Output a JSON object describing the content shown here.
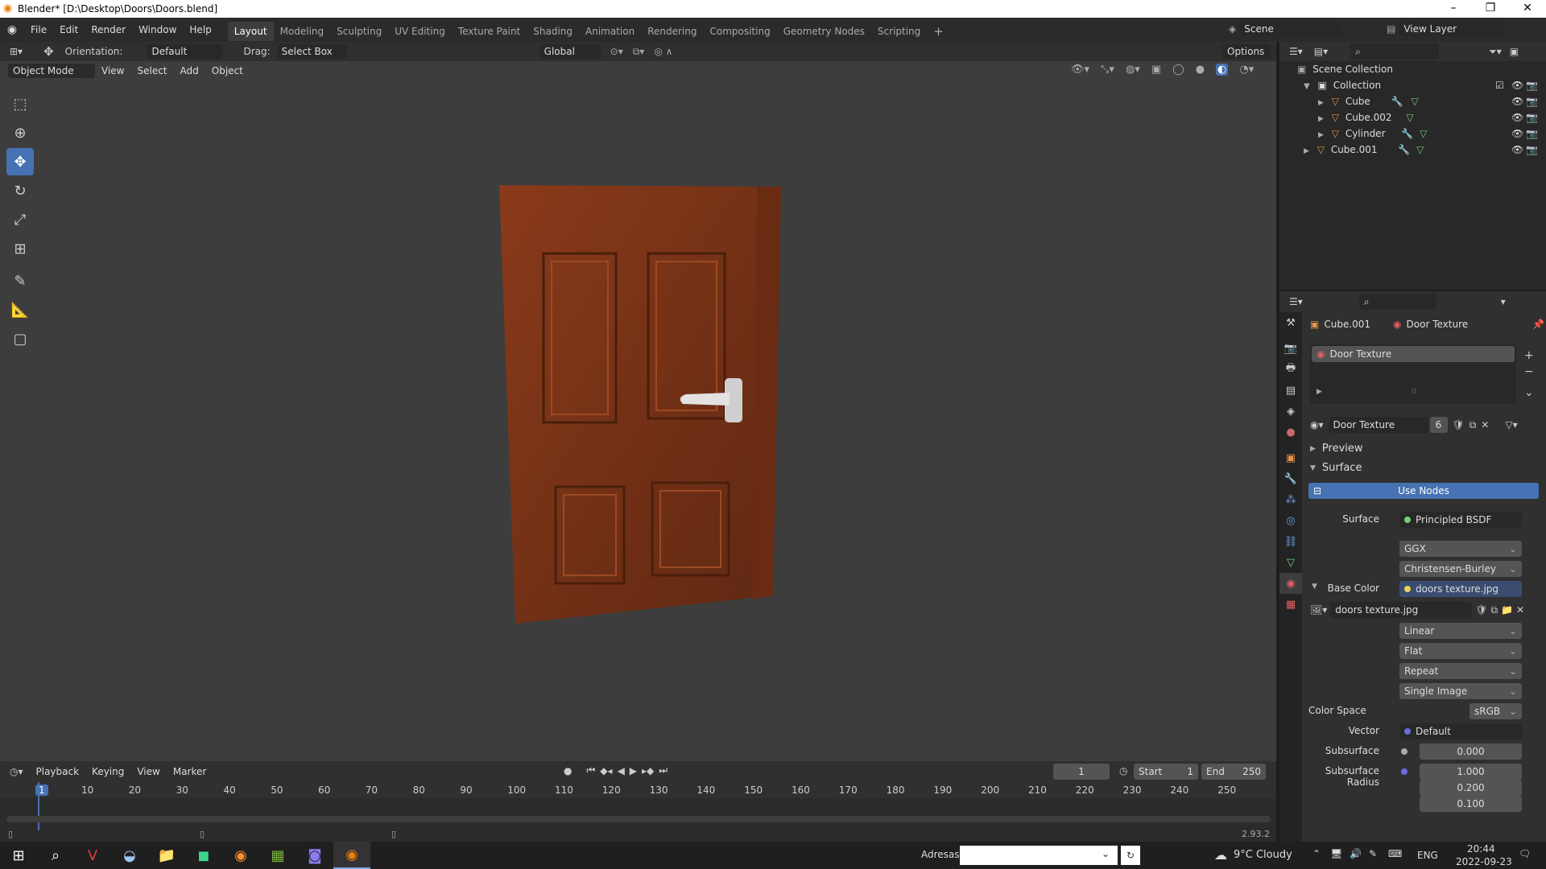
{
  "window": {
    "title": "Blender* [D:\\Desktop\\Doors\\Doors.blend]"
  },
  "menu": [
    "File",
    "Edit",
    "Render",
    "Window",
    "Help"
  ],
  "workspaces": [
    "Layout",
    "Modeling",
    "Sculpting",
    "UV Editing",
    "Texture Paint",
    "Shading",
    "Animation",
    "Rendering",
    "Compositing",
    "Geometry Nodes",
    "Scripting"
  ],
  "scene": {
    "name": "Scene",
    "view_layer": "View Layer"
  },
  "viewport_header": {
    "orientation_label": "Orientation:",
    "orientation_value": "Default",
    "drag_label": "Drag:",
    "drag_value": "Select Box",
    "transform_orientation": "Global",
    "options": "Options"
  },
  "viewport_header2": {
    "mode": "Object Mode",
    "menus": [
      "View",
      "Select",
      "Add",
      "Object"
    ]
  },
  "outliner": {
    "root": "Scene Collection",
    "collection": "Collection",
    "items": [
      "Cube",
      "Cube.002",
      "Cylinder"
    ],
    "extra": "Cube.001"
  },
  "properties": {
    "object": "Cube.001",
    "material": "Door Texture",
    "slot": "Door Texture",
    "material_field": "Door Texture",
    "user_count": "6",
    "preview_label": "Preview",
    "surface_label": "Surface",
    "use_nodes": "Use Nodes",
    "rows": {
      "surface_label": "Surface",
      "surface_value": "Principled BSDF",
      "distribution": "GGX",
      "subsurface_method": "Christensen-Burley",
      "base_color_label": "Base Color",
      "base_color_value": "doors texture.jpg",
      "image_name": "doors texture.jpg",
      "interpolation": "Linear",
      "projection": "Flat",
      "extension": "Repeat",
      "source": "Single Image",
      "color_space_label": "Color Space",
      "color_space_value": "sRGB",
      "vector_label": "Vector",
      "vector_value": "Default",
      "subsurface_label": "Subsurface",
      "subsurface_value": "0.000",
      "radius_label": "Subsurface Radius",
      "radius_values": [
        "1.000",
        "0.200",
        "0.100"
      ]
    }
  },
  "timeline": {
    "menus": [
      "Playback",
      "Keying",
      "View",
      "Marker"
    ],
    "current_frame": "1",
    "start_label": "Start",
    "start": "1",
    "end_label": "End",
    "end": "250",
    "ruler": [
      "1",
      "10",
      "20",
      "30",
      "40",
      "50",
      "60",
      "70",
      "80",
      "90",
      "100",
      "110",
      "120",
      "130",
      "140",
      "150",
      "160",
      "170",
      "180",
      "190",
      "200",
      "210",
      "220",
      "230",
      "240",
      "250"
    ]
  },
  "status": {
    "version": "2.93.2"
  },
  "taskbar": {
    "address_label": "Adresas",
    "weather": "9°C  Cloudy",
    "language": "ENG",
    "time": "20:44",
    "date": "2022-09-23"
  },
  "colors": {
    "accent": "#4772b3",
    "door": "#7a3418",
    "bg": "#3d3d3d"
  }
}
